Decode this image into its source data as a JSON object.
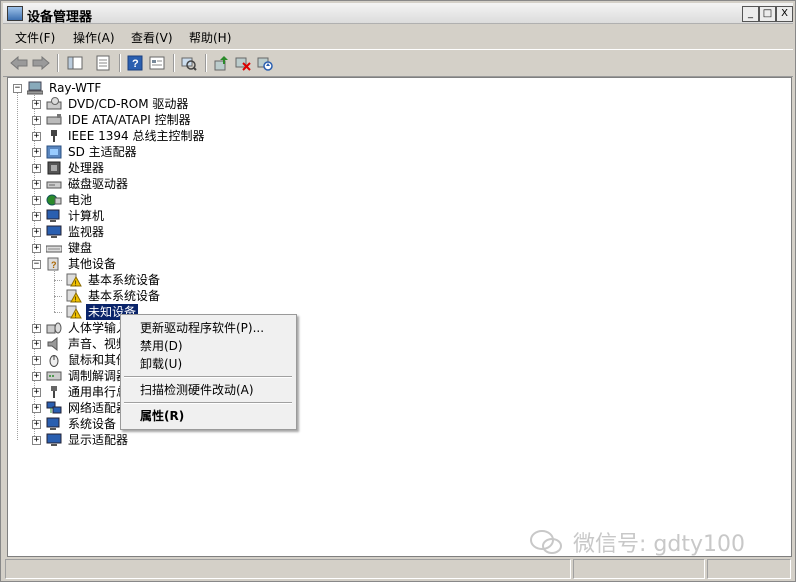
{
  "window": {
    "title": "设备管理器"
  },
  "window_controls": {
    "minimize": "_",
    "maximize": "□",
    "close": "X"
  },
  "menubar": [
    {
      "label": "文件(F)"
    },
    {
      "label": "操作(A)"
    },
    {
      "label": "查看(V)"
    },
    {
      "label": "帮助(H)"
    }
  ],
  "toolbar": [
    "back-arrow-icon",
    "forward-arrow-icon",
    "console-tree-icon",
    "properties-icon",
    "help-icon",
    "view-icon",
    "scan-hardware-icon",
    "update-driver-icon",
    "uninstall-icon",
    "disable-icon"
  ],
  "tree": {
    "root": "Ray-WTF",
    "categories": [
      {
        "label": "DVD/CD-ROM 驱动器",
        "icon": "dvd-drive-icon"
      },
      {
        "label": "IDE ATA/ATAPI 控制器",
        "icon": "ide-controller-icon"
      },
      {
        "label": "IEEE 1394 总线主控制器",
        "icon": "ieee1394-icon"
      },
      {
        "label": "SD 主适配器",
        "icon": "sd-adapter-icon"
      },
      {
        "label": "处理器",
        "icon": "processor-icon"
      },
      {
        "label": "磁盘驱动器",
        "icon": "disk-drive-icon"
      },
      {
        "label": "电池",
        "icon": "battery-icon"
      },
      {
        "label": "计算机",
        "icon": "computer-icon"
      },
      {
        "label": "监视器",
        "icon": "monitor-icon"
      },
      {
        "label": "键盘",
        "icon": "keyboard-icon"
      },
      {
        "label": "其他设备",
        "icon": "other-devices-icon"
      }
    ],
    "other_devices_children": [
      {
        "label": "基本系统设备"
      },
      {
        "label": "基本系统设备"
      },
      {
        "label": "未知设备"
      }
    ],
    "more_categories": [
      {
        "label": "人体学输入设备",
        "icon": "hid-icon"
      },
      {
        "label": "声音、视频和游戏控制器",
        "icon": "sound-icon"
      },
      {
        "label": "鼠标和其他指针设备",
        "icon": "mouse-icon"
      },
      {
        "label": "调制解调器",
        "icon": "modem-icon"
      },
      {
        "label": "通用串行总线控制器",
        "icon": "usb-icon"
      },
      {
        "label": "网络适配器",
        "icon": "network-adapter-icon"
      },
      {
        "label": "系统设备",
        "icon": "system-devices-icon"
      },
      {
        "label": "显示适配器",
        "icon": "display-adapter-icon"
      }
    ]
  },
  "context_menu": {
    "update_driver": "更新驱动程序软件(P)...",
    "disable": "禁用(D)",
    "uninstall": "卸载(U)",
    "scan": "扫描检测硬件改动(A)",
    "properties": "属性(R)"
  },
  "watermark": "微信号: gdty100"
}
